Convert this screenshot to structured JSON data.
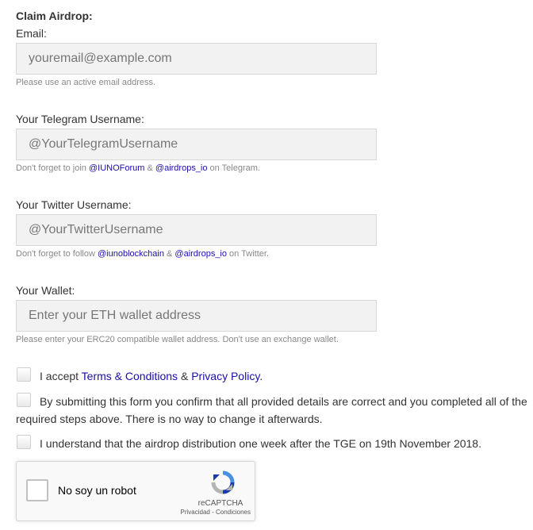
{
  "form": {
    "title": "Claim Airdrop:",
    "email": {
      "label": "Email:",
      "placeholder": "youremail@example.com",
      "help": "Please use an active email address."
    },
    "telegram": {
      "label": "Your Telegram Username:",
      "placeholder": "@YourTelegramUsername",
      "help_prefix": "Don't forget to join ",
      "link1": "@IUNOForum",
      "join": " & ",
      "link2": "@airdrops_io",
      "help_suffix": " on Telegram."
    },
    "twitter": {
      "label": "Your Twitter Username:",
      "placeholder": "@YourTwitterUsername",
      "help_prefix": "Don't forget to follow ",
      "link1": "@iunoblockchain",
      "join": " & ",
      "link2": "@airdrops_io",
      "help_suffix": " on Twitter."
    },
    "wallet": {
      "label": "Your Wallet:",
      "placeholder": "Enter your ETH wallet address",
      "help": "Please enter your ERC20 compatible wallet address. Don't use an exchange wallet."
    },
    "checks": {
      "terms_prefix": "I accept ",
      "terms_link": "Terms & Conditions",
      "terms_join": " & ",
      "privacy_link": "Privacy Policy",
      "terms_suffix": ".",
      "confirm": "By submitting this form you confirm that all provided details are correct and you completed all of the required steps above. There is no way to change it afterwards.",
      "distribution": "I understand that the airdrop distribution one week after the TGE on 19th November 2018."
    }
  },
  "recaptcha": {
    "label": "No soy un robot",
    "brand": "reCAPTCHA",
    "privacy": "Privacidad",
    "separator": " - ",
    "terms": "Condiciones"
  },
  "colors": {
    "link": "#1a0dab",
    "field_bg": "#f2f2f2",
    "recaptcha_blue": "#4a90e2",
    "recaptcha_gray": "#b4b4b4"
  }
}
